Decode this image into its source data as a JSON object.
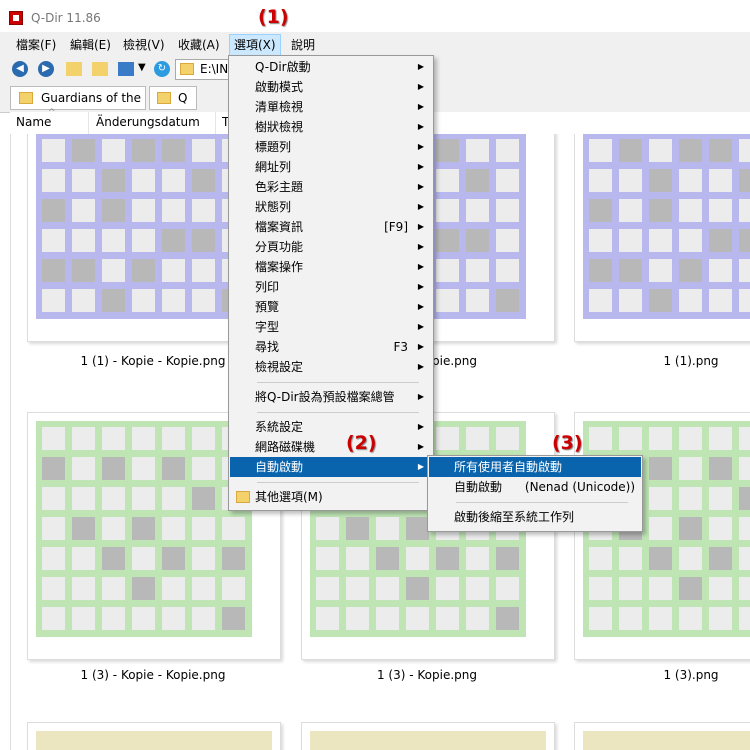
{
  "window": {
    "title": "Q-Dir 11.86"
  },
  "menubar": {
    "items": [
      "檔案(F)",
      "編輯(E)",
      "檢視(V)",
      "收藏(A)",
      "選項(X)",
      "說明"
    ]
  },
  "toolbar": {
    "address": "E:\\INI"
  },
  "tabs": [
    {
      "label": "Guardians of the ..."
    },
    {
      "label": "Q"
    }
  ],
  "columns": [
    "Name",
    "Änderungsdatum",
    "T"
  ],
  "files": [
    {
      "name": "1 (1) - Kopie - Kopie.png",
      "color": "#b9b8ee"
    },
    {
      "name": "1 (1) - Kopie.png",
      "color": "#b9b8ee"
    },
    {
      "name": "1 (1).png",
      "color": "#b9b8ee"
    },
    {
      "name": "1 (3) - Kopie - Kopie.png",
      "color": "#bfe5b5"
    },
    {
      "name": "1 (3) - Kopie.png",
      "color": "#bfe5b5"
    },
    {
      "name": "1 (3).png",
      "color": "#bfe5b5"
    }
  ],
  "options_menu": {
    "items": [
      {
        "label": "Q-Dir啟動",
        "submenu": true
      },
      {
        "label": "啟動模式",
        "submenu": true
      },
      {
        "label": "清單檢視",
        "submenu": true
      },
      {
        "label": "樹狀檢視",
        "submenu": true
      },
      {
        "label": "標題列",
        "submenu": true
      },
      {
        "label": "網址列",
        "submenu": true
      },
      {
        "label": "色彩主題",
        "submenu": true
      },
      {
        "label": "狀態列",
        "submenu": true
      },
      {
        "label": "檔案資訊",
        "shortcut": "[F9]",
        "submenu": true
      },
      {
        "label": "分頁功能",
        "submenu": true
      },
      {
        "label": "檔案操作",
        "submenu": true
      },
      {
        "label": "列印",
        "submenu": true
      },
      {
        "label": "預覽",
        "submenu": true
      },
      {
        "label": "字型",
        "submenu": true
      },
      {
        "label": "尋找",
        "shortcut": "F3",
        "submenu": true
      },
      {
        "label": "檢視設定",
        "submenu": true
      },
      {
        "label": "將Q-Dir設為預設檔案總管",
        "submenu": true
      },
      {
        "label": "系統設定",
        "submenu": true
      },
      {
        "label": "網路磁碟機",
        "submenu": true
      },
      {
        "label": "自動啟動",
        "submenu": true
      },
      {
        "label": "其他選項(M)",
        "submenu": false
      }
    ]
  },
  "autostart_submenu": {
    "items": [
      {
        "label": "所有使用者自動啟動"
      },
      {
        "label": "自動啟動      (Nenad (Unicode))"
      },
      {
        "label": "啟動後縮至系統工作列"
      }
    ]
  },
  "annotations": [
    "(1)",
    "(2)",
    "(3)"
  ],
  "colors": {
    "highlight": "#0a64ad",
    "annotation": "#cc0000",
    "purple_thumb": "#b9b8ee",
    "green_thumb": "#bfe5b5",
    "yellow_thumb": "#ebe6c0"
  }
}
